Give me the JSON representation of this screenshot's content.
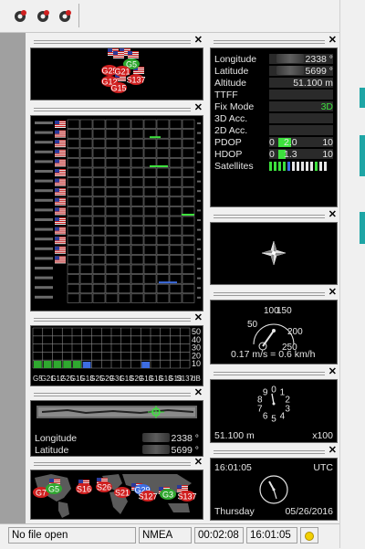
{
  "toolbar": {
    "icons": [
      "gps-gear-icon",
      "gps-gear-icon",
      "gps-gear-icon"
    ]
  },
  "sky_view": {
    "sats": [
      {
        "id": "G5",
        "c": "#2fa82f"
      },
      {
        "id": "G29",
        "c": "#d02020"
      },
      {
        "id": "G21",
        "c": "#d02020"
      },
      {
        "id": "G12",
        "c": "#d02020"
      },
      {
        "id": "G15",
        "c": "#d02020"
      },
      {
        "id": "S137",
        "c": "#d02020"
      }
    ]
  },
  "signal_columns": 10,
  "signal_rows": 19,
  "bar_chart": {
    "scale": [
      "50",
      "40",
      "30",
      "20",
      "10"
    ],
    "unit": "dB",
    "labels": [
      "G5",
      "G21",
      "G12",
      "G25",
      "G15",
      "G13",
      "G25",
      "G29",
      "G31",
      "G13",
      "G29",
      "G13",
      "G13",
      "G13",
      "G13",
      "S137"
    ]
  },
  "map": {
    "labels": [
      {
        "k": "Longitude",
        "v": "2338 °"
      },
      {
        "k": "Latitude",
        "v": "5699 °"
      }
    ]
  },
  "world": {
    "sats": [
      "G7",
      "G5",
      "S16",
      "S26",
      "S21",
      "G29",
      "S127",
      "G3",
      "S137"
    ]
  },
  "data_panel": {
    "rows": [
      {
        "label": "Longitude",
        "value": "2338 °",
        "blur": true
      },
      {
        "label": "Latitude",
        "value": "5699 °",
        "blur": true
      },
      {
        "label": "Altitude",
        "value": "51.100 m"
      },
      {
        "label": "TTFF",
        "value": ""
      },
      {
        "label": "Fix Mode",
        "value": "3D"
      },
      {
        "label": "3D Acc.",
        "value": ""
      },
      {
        "label": "2D Acc.",
        "value": ""
      }
    ],
    "pdop": {
      "label": "PDOP",
      "min": "0",
      "value": "2.0",
      "max": "10"
    },
    "hdop": {
      "label": "HDOP",
      "min": "0",
      "value": "1.3",
      "max": "10"
    },
    "satellites_label": "Satellites"
  },
  "speed": {
    "ticks": [
      "100",
      "150",
      "50",
      "200",
      "250"
    ],
    "readout": "0.17 m/s = 0.6 km/h"
  },
  "altimeter": {
    "numbers": [
      "0",
      "1",
      "2",
      "3",
      "4",
      "5",
      "6",
      "7",
      "8",
      "9"
    ],
    "altitude": "51.100 m",
    "scale": "x100"
  },
  "clock": {
    "time": "16:01:05",
    "zone": "UTC",
    "day": "Thursday",
    "date": "05/26/2016"
  },
  "statusbar": {
    "file": "No file open",
    "protocol": "NMEA",
    "elapsed": "00:02:08",
    "time": "16:01:05"
  }
}
